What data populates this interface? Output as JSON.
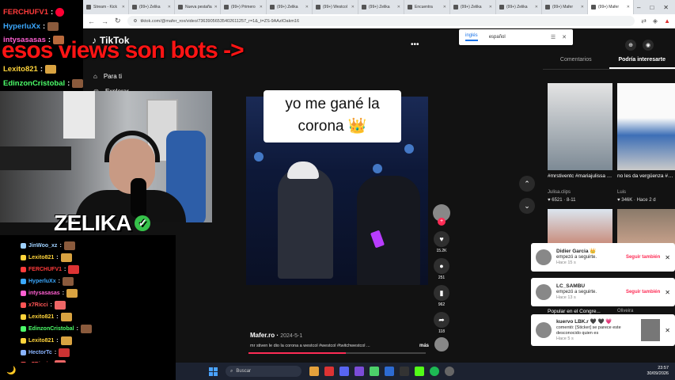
{
  "browser": {
    "tabs": [
      {
        "label": "Stream - Kick"
      },
      {
        "label": "(99+) Zelika"
      },
      {
        "label": "Nueva pestaña"
      },
      {
        "label": "(99+) Primero"
      },
      {
        "label": "(99+) Zelika"
      },
      {
        "label": "(99+) Westcol"
      },
      {
        "label": "(99+) Zelika"
      },
      {
        "label": "Encuentra"
      },
      {
        "label": "(99+) Zelika"
      },
      {
        "label": "(99+) Zelika"
      },
      {
        "label": "(99+) Mafer"
      },
      {
        "label": "(99+) Mafer"
      }
    ],
    "active_tab": 11,
    "url": "tiktok.com/@mafer_rox/video/73639056535402611257_r=1&_t=ZS-9AAzIOakm16"
  },
  "translate_popup": {
    "lang_a": "inglés",
    "lang_b": "español"
  },
  "tiktok": {
    "logo": "TikTok",
    "nav": [
      {
        "label": "Para ti"
      },
      {
        "label": "Explorar"
      }
    ],
    "caption_line1": "yo me gané la",
    "caption_line2": "corona 👑",
    "author": "Mafer.ro",
    "date": "2024-5-1",
    "description": "mr stiven le dio la corona a westcol #westcol #twitchwestcol ...",
    "more": "más",
    "progress": 0.55,
    "actions": {
      "likes": "15.2K",
      "comments": "251",
      "saves": "962",
      "shares": "118"
    }
  },
  "right_panel": {
    "tabs": [
      "Comentarios",
      "Podría interesarte"
    ],
    "active_tab": 1,
    "videos": [
      {
        "title": "#mrstiventc #mariajulissa #cali...",
        "user": "Julisa.clips",
        "views": "6521",
        "age": "8-11"
      },
      {
        "title": "no les da vergüenza #premierleague...",
        "user": "Luis",
        "views": "346K",
        "age": "Hace 2 d"
      }
    ],
    "section_label": "Popular en el Congre...",
    "section_user": "Oliveira"
  },
  "notifications": [
    {
      "name": "Didier Garcia 👑",
      "text": "empezó a seguirte.",
      "time": "Hace 15 s",
      "action": "Seguir también"
    },
    {
      "name": "LC_SAMBU",
      "text": "empezó a seguirte.",
      "time": "Hace 13 s",
      "action": "Seguir también"
    },
    {
      "name": "kuervo LBK.r 🖤 🖤 💗",
      "text": "comentó: [Sticker] se parece este desconocido quien es",
      "time": "Hace 5 s",
      "action": ""
    }
  ],
  "stream_overlay": {
    "top_chat": [
      {
        "user": "FERCHUFV1",
        "color": "#ff3b3b"
      },
      {
        "user": "HyperluXx",
        "color": "#3ba9ff"
      },
      {
        "user": "intysasasas",
        "color": "#ff5fd2"
      },
      {
        "user": "Lexito821",
        "color": "#ffd43b"
      },
      {
        "user": "EdinzonCristobal",
        "color": "#4cff6a"
      }
    ],
    "banner": "esos views son bots ->",
    "streamer": "ZELIKA",
    "bottom_chat": [
      {
        "user": "JinWoo_xz",
        "color": "#9fd1ff"
      },
      {
        "user": "Lexito821",
        "color": "#ffd43b"
      },
      {
        "user": "FERCHUFV1",
        "color": "#ff3b3b"
      },
      {
        "user": "HyperluXx",
        "color": "#3ba9ff"
      },
      {
        "user": "intysasasas",
        "color": "#ff5fd2"
      },
      {
        "user": "x7Ricci",
        "color": "#ff5555"
      },
      {
        "user": "Lexito821",
        "color": "#ffd43b"
      },
      {
        "user": "EdinzonCristobal",
        "color": "#4cff6a"
      },
      {
        "user": "Lexito821",
        "color": "#ffd43b"
      },
      {
        "user": "HectorTc",
        "color": "#8ab4ff"
      },
      {
        "user": "x7Ricci",
        "color": "#ff5555"
      }
    ]
  },
  "taskbar": {
    "search_placeholder": "Buscar",
    "time": "23:57",
    "date": "30/09/2026"
  }
}
